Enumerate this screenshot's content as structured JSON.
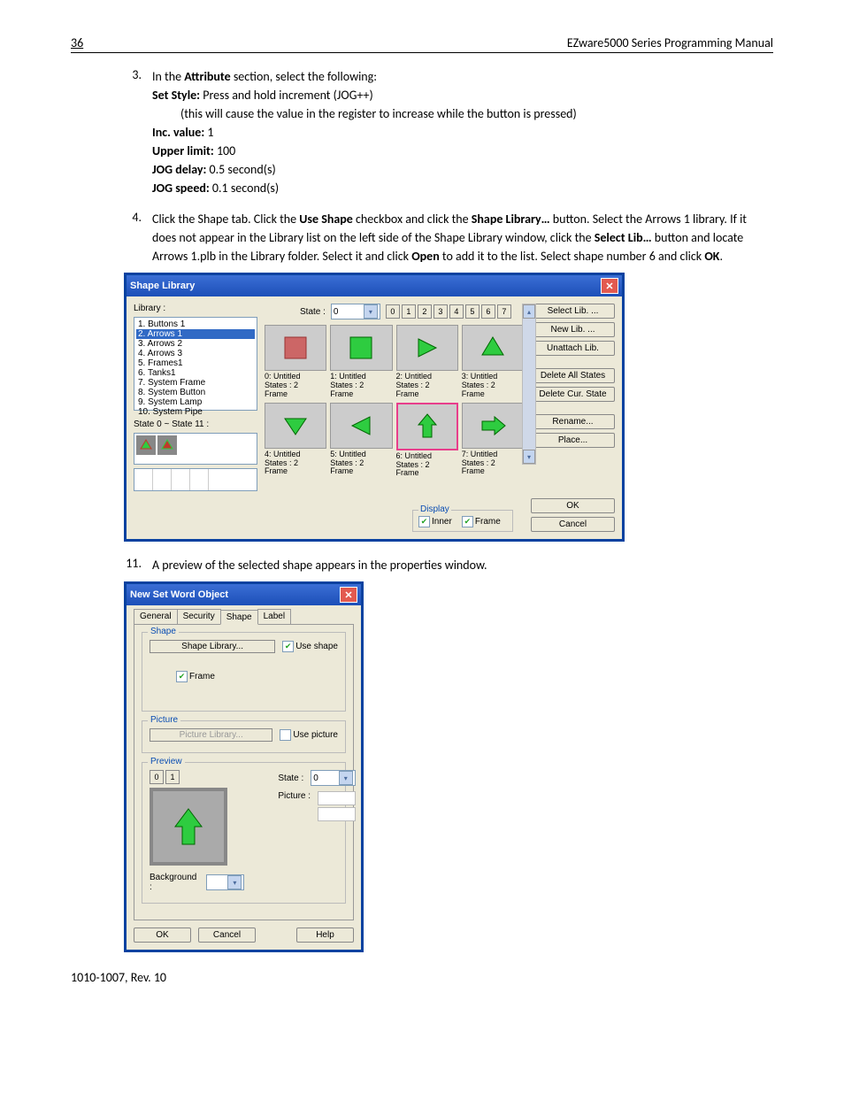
{
  "header": {
    "page": "36",
    "title": "EZware5000 Series Programming Manual"
  },
  "step3": {
    "num": "3.",
    "intro_pre": "In the ",
    "intro_b": "Attribute",
    "intro_post": " section, select the following:",
    "l1_b": "Set Style:",
    "l1_t": " Press and hold increment (JOG++)",
    "l2": "(this will cause the value in the register to increase while the button is pressed)",
    "l3_b": "Inc. value:",
    "l3_t": " 1",
    "l4_b": "Upper limit:",
    "l4_t": " 100",
    "l5_b": "JOG delay:",
    "l5_t": " 0.5 second(s)",
    "l6_b": "JOG speed:",
    "l6_t": " 0.1 second(s)"
  },
  "step4": {
    "num": "4.",
    "t1": "Click the Shape tab. Click the ",
    "b1": "Use Shape",
    "t2": " checkbox and click the ",
    "b2": "Shape Library…",
    "t3": " button. Select the Arrows 1 library. If it does not appear in the Library list on the left side of the Shape Library window, click the ",
    "b3": "Select Lib…",
    "t4": " button and locate Arrows 1.plb in the Library folder. Select it and click ",
    "b4": "Open",
    "t5": " to add it to the list. Select shape number 6 and click ",
    "b5": "OK",
    "t6": "."
  },
  "shapelib": {
    "title": "Shape Library",
    "library_lbl": "Library :",
    "state_lbl": "State :",
    "state_val": "0",
    "numbtns": [
      "0",
      "1",
      "2",
      "3",
      "4",
      "5",
      "6",
      "7"
    ],
    "list": [
      "1. Buttons 1",
      "2. Arrows 1",
      "3. Arrows 2",
      "4. Arrows 3",
      "5. Frames1",
      "6. Tanks1",
      "7. System Frame",
      "8. System Button",
      "9. System Lamp",
      "10. System Pipe"
    ],
    "selected_index": 1,
    "state_range": "State 0 ~ State 11 :",
    "cells": [
      {
        "l1": "0: Untitled",
        "l2": "States : 2",
        "l3": "Frame"
      },
      {
        "l1": "1: Untitled",
        "l2": "States : 2",
        "l3": "Frame"
      },
      {
        "l1": "2: Untitled",
        "l2": "States : 2",
        "l3": "Frame"
      },
      {
        "l1": "3: Untitled",
        "l2": "States : 2",
        "l3": "Frame"
      },
      {
        "l1": "4: Untitled",
        "l2": "States : 2",
        "l3": "Frame"
      },
      {
        "l1": "5: Untitled",
        "l2": "States : 2",
        "l3": "Frame"
      },
      {
        "l1": "6: Untitled",
        "l2": "States : 2",
        "l3": "Frame"
      },
      {
        "l1": "7: Untitled",
        "l2": "States : 2",
        "l3": "Frame"
      }
    ],
    "btns": {
      "select": "Select Lib. ...",
      "new": "New Lib. ...",
      "unattach": "Unattach Lib.",
      "delall": "Delete All States",
      "delcur": "Delete Cur. State",
      "rename": "Rename...",
      "place": "Place..."
    },
    "display": {
      "title": "Display",
      "inner": "Inner",
      "frame": "Frame"
    },
    "ok": "OK",
    "cancel": "Cancel"
  },
  "step11": {
    "num": "11.",
    "text": "A preview of the selected shape appears in the properties window."
  },
  "newobj": {
    "title": "New  Set Word Object",
    "tabs": [
      "General",
      "Security",
      "Shape",
      "Label"
    ],
    "shape_grp": "Shape",
    "shape_btn": "Shape Library...",
    "use_shape": "Use shape",
    "frame_chk": "Frame",
    "picture_grp": "Picture",
    "picture_btn": "Picture Library...",
    "use_picture": "Use picture",
    "preview_grp": "Preview",
    "state_lbl": "State :",
    "state_val": "0",
    "picture_lbl": "Picture :",
    "bg_lbl": "Background :",
    "states": [
      "0",
      "1"
    ],
    "ok": "OK",
    "cancel": "Cancel",
    "help": "Help"
  },
  "footer": "1010-1007, Rev. 10"
}
